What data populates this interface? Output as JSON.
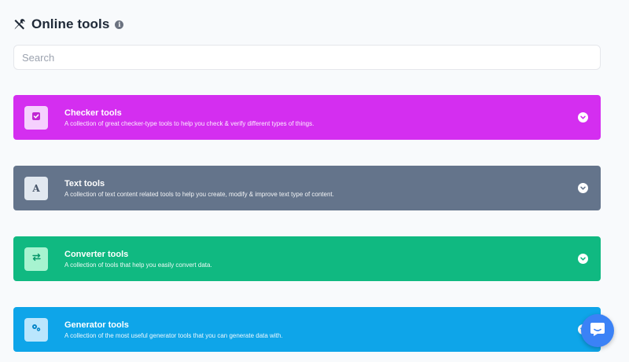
{
  "header": {
    "title": "Online tools",
    "info_glyph": "i",
    "icon": "tools-icon"
  },
  "search": {
    "placeholder": "Search",
    "value": ""
  },
  "cards": [
    {
      "title": "Checker tools",
      "description": "A collection of great checker-type tools to help you check & verify different types of things.",
      "color": "#d42ef0",
      "badge_bg": "#f5d0fe",
      "badge_fg": "#c026d3",
      "icon": "check-square-icon"
    },
    {
      "title": "Text tools",
      "description": "A collection of text content related tools to help you create, modify & improve text type of content.",
      "color": "#64748b",
      "badge_bg": "#e2e8f0",
      "badge_fg": "#475569",
      "icon": "letter-a-icon",
      "badge_glyph": "A"
    },
    {
      "title": "Converter tools",
      "description": "A collection of tools that help you easily convert data.",
      "color": "#10b981",
      "badge_bg": "#a7f3d0",
      "badge_fg": "#059669",
      "icon": "arrows-exchange-icon"
    },
    {
      "title": "Generator tools",
      "description": "A collection of the most useful generator tools that you can generate data with.",
      "color": "#0ea5e9",
      "badge_bg": "#bae6fd",
      "badge_fg": "#0284c7",
      "icon": "cogs-icon"
    }
  ],
  "chat": {
    "icon": "chat-icon",
    "color": "#3b82f6"
  }
}
